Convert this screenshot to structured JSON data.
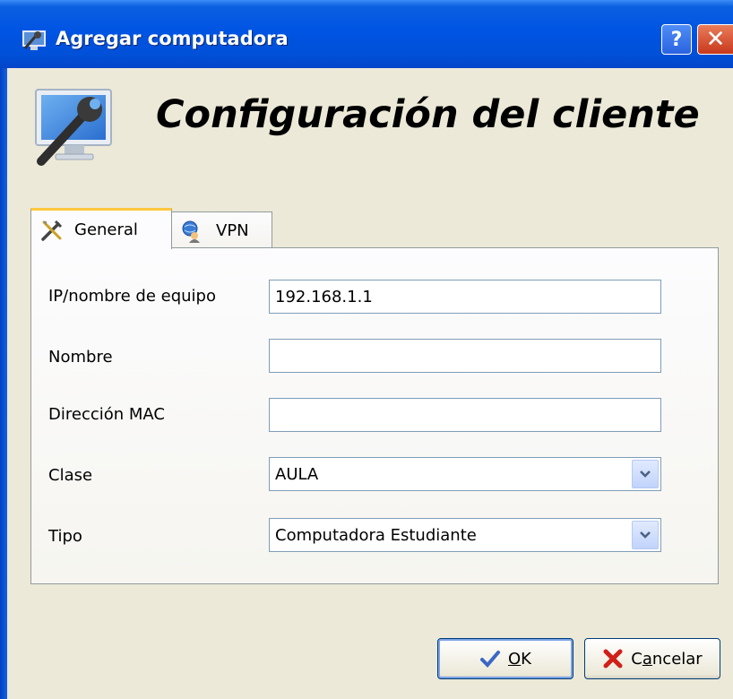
{
  "window": {
    "title": "Agregar computadora",
    "help_button": "?",
    "close_button": "✕"
  },
  "header": {
    "title": "Configuración del cliente",
    "icon": "computer-wrench-icon"
  },
  "tabs": [
    {
      "label": "General",
      "icon": "tools-icon",
      "selected": true
    },
    {
      "label": "VPN",
      "icon": "globe-user-icon",
      "selected": false
    }
  ],
  "form": {
    "ip": {
      "label": "IP/nombre de equipo",
      "value": "192.168.1.1"
    },
    "nombre": {
      "label": "Nombre",
      "value": ""
    },
    "mac": {
      "label": "Dirección MAC",
      "value": ""
    },
    "clase": {
      "label": "Clase",
      "value": "AULA"
    },
    "tipo": {
      "label": "Tipo",
      "value": "Computadora Estudiante"
    }
  },
  "buttons": {
    "ok": {
      "mnemonic": "O",
      "rest": "K",
      "icon": "checkmark-icon"
    },
    "cancel": {
      "pre": "C",
      "mnemonic": "a",
      "rest": "ncelar",
      "icon": "red-x-icon"
    }
  },
  "colors": {
    "titlebar": "#0054e3",
    "tab_highlight": "#ffc83c",
    "input_border": "#7f9db9"
  }
}
